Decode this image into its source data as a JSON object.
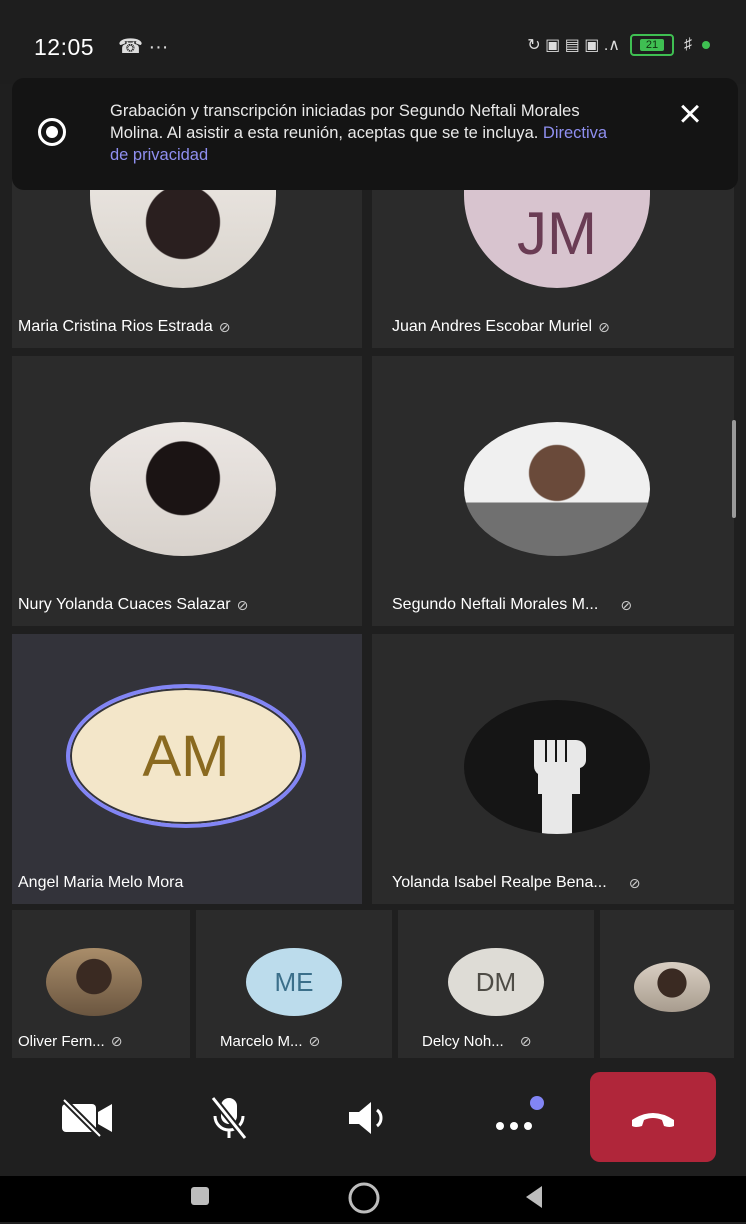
{
  "status": {
    "time": "12:05",
    "left_icons": "☎ ···",
    "right_icons": "↻ ▣ ▤ ▣ .∧",
    "battery": "21"
  },
  "banner": {
    "text": "Grabación y transcripción iniciadas por Segundo Neftali Morales Molina. Al asistir a esta reunión, aceptas que se te incluya.",
    "link": "Directiva de privacidad",
    "close": "×"
  },
  "tiles": [
    {
      "name": "Maria Cristina Rios Estrada",
      "avatar": "photo"
    },
    {
      "name": "Juan Andres Escobar Muriel",
      "initials": "JM"
    },
    {
      "name": "Nury Yolanda Cuaces Salazar",
      "avatar": "photo"
    },
    {
      "name": "Segundo Neftali Morales M...",
      "avatar": "photo"
    },
    {
      "name": "Angel Maria Melo Mora",
      "initials": "AM"
    },
    {
      "name": "Yolanda Isabel Realpe Bena...",
      "avatar": "photo"
    }
  ],
  "small_tiles": [
    {
      "name": "Oliver Fern...",
      "avatar": "photo"
    },
    {
      "name": "Marcelo  M...",
      "initials": "ME"
    },
    {
      "name": "Delcy Noh...",
      "initials": "DM"
    },
    {
      "name": "",
      "avatar": "photo"
    }
  ],
  "controls": {
    "camera": "camera-off",
    "mic": "mic-off",
    "speaker": "speaker",
    "more": "more",
    "end": "end-call"
  },
  "mute_glyph": "⊘",
  "colors": {
    "accent": "#8285f5",
    "end_call": "#b0263a",
    "am_bg": "#f3e6c9",
    "am_text": "#8a6a20",
    "jm_bg": "#d8c4cf",
    "jm_text": "#6a3c54",
    "me_bg": "#bcdcec",
    "me_text": "#3b6f8a",
    "dm_bg": "#dedcd6",
    "dm_text": "#4e4c46"
  }
}
